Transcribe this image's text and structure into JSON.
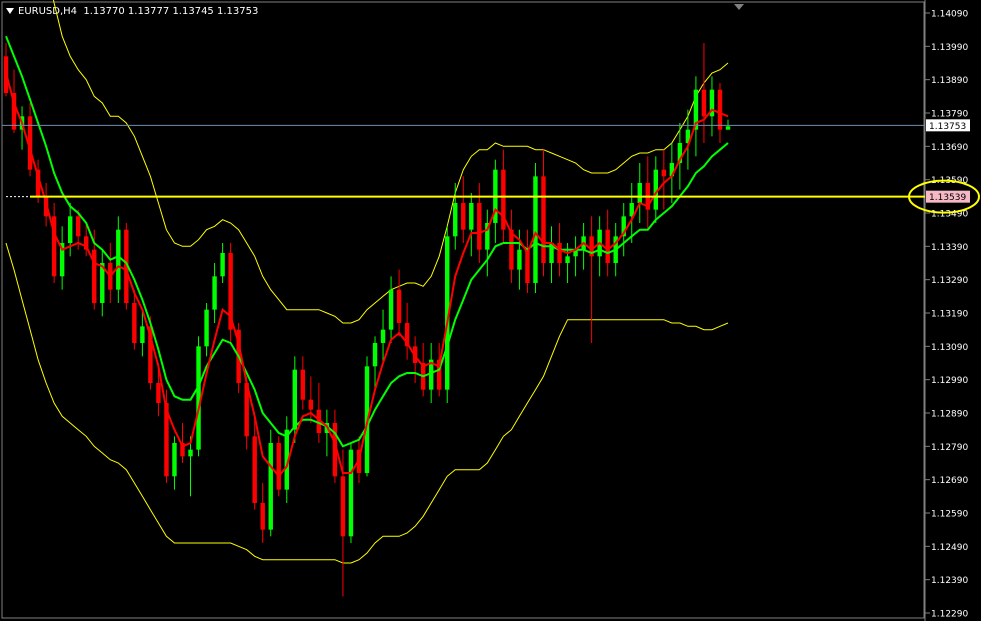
{
  "header": {
    "symbol_timeframe": "EURUSD,H4",
    "ohlc": "1.13770 1.13777 1.13745 1.13753"
  },
  "colors": {
    "background": "#000000",
    "bull_candle": "#00ff00",
    "bear_candle": "#ff0000",
    "ma_fast": "#ff0000",
    "ma_slow": "#00ff00",
    "envelope": "#ffff00",
    "price_line": "#6f8fae",
    "horizontal_line": "#ffff00",
    "highlight_circle": "#ffff00"
  },
  "chart_data": {
    "type": "candlestick",
    "symbol": "EURUSD",
    "timeframe": "H4",
    "ylim": [
      1.1229,
      1.1409
    ],
    "y_ticks": [
      "1.14090",
      "1.13990",
      "1.13890",
      "1.13790",
      "1.13690",
      "1.13590",
      "1.13490",
      "1.13390",
      "1.13290",
      "1.13190",
      "1.13090",
      "1.12990",
      "1.12890",
      "1.12790",
      "1.12690",
      "1.12590",
      "1.12490",
      "1.12390",
      "1.12290"
    ],
    "current_price": 1.13753,
    "current_price_label": "1.13753",
    "horizontal_line": 1.13539,
    "horizontal_line_label": "1.13539",
    "candles": [
      [
        1.1396,
        1.14,
        1.1384,
        1.1385
      ],
      [
        1.1385,
        1.1392,
        1.1373,
        1.1374
      ],
      [
        1.1374,
        1.1381,
        1.1368,
        1.1378
      ],
      [
        1.1378,
        1.1382,
        1.136,
        1.1362
      ],
      [
        1.1362,
        1.1365,
        1.1352,
        1.1354
      ],
      [
        1.1354,
        1.1358,
        1.1345,
        1.1348
      ],
      [
        1.1348,
        1.1352,
        1.1328,
        1.133
      ],
      [
        1.133,
        1.1345,
        1.1326,
        1.134
      ],
      [
        1.134,
        1.1352,
        1.1336,
        1.1348
      ],
      [
        1.1348,
        1.135,
        1.1338,
        1.1342
      ],
      [
        1.1342,
        1.1346,
        1.1336,
        1.1338
      ],
      [
        1.1338,
        1.1344,
        1.132,
        1.1322
      ],
      [
        1.1322,
        1.1338,
        1.1318,
        1.1334
      ],
      [
        1.1334,
        1.134,
        1.1322,
        1.1326
      ],
      [
        1.1326,
        1.1348,
        1.1322,
        1.1344
      ],
      [
        1.1344,
        1.1346,
        1.132,
        1.1322
      ],
      [
        1.1322,
        1.1326,
        1.1308,
        1.131
      ],
      [
        1.131,
        1.132,
        1.1306,
        1.1315
      ],
      [
        1.1315,
        1.1318,
        1.1296,
        1.1298
      ],
      [
        1.1298,
        1.1304,
        1.1288,
        1.1292
      ],
      [
        1.1292,
        1.1296,
        1.1268,
        1.127
      ],
      [
        1.127,
        1.1282,
        1.1266,
        1.128
      ],
      [
        1.128,
        1.1286,
        1.1274,
        1.1276
      ],
      [
        1.1276,
        1.1282,
        1.1264,
        1.1278
      ],
      [
        1.1278,
        1.1312,
        1.1276,
        1.1309
      ],
      [
        1.1309,
        1.1322,
        1.1306,
        1.132
      ],
      [
        1.132,
        1.1334,
        1.1316,
        1.133
      ],
      [
        1.133,
        1.134,
        1.1328,
        1.1337
      ],
      [
        1.1337,
        1.134,
        1.131,
        1.1314
      ],
      [
        1.1314,
        1.1316,
        1.1295,
        1.1298
      ],
      [
        1.1298,
        1.13,
        1.1278,
        1.1282
      ],
      [
        1.1282,
        1.1288,
        1.126,
        1.1262
      ],
      [
        1.1262,
        1.1268,
        1.125,
        1.1254
      ],
      [
        1.1254,
        1.1284,
        1.1252,
        1.128
      ],
      [
        1.128,
        1.1282,
        1.1264,
        1.1266
      ],
      [
        1.1266,
        1.1288,
        1.1262,
        1.1284
      ],
      [
        1.1284,
        1.1306,
        1.128,
        1.1302
      ],
      [
        1.1302,
        1.1306,
        1.129,
        1.1293
      ],
      [
        1.1293,
        1.13,
        1.1286,
        1.129
      ],
      [
        1.129,
        1.1298,
        1.128,
        1.1283
      ],
      [
        1.1283,
        1.129,
        1.1276,
        1.1286
      ],
      [
        1.1286,
        1.129,
        1.1268,
        1.127
      ],
      [
        1.127,
        1.1278,
        1.1234,
        1.1252
      ],
      [
        1.1252,
        1.128,
        1.125,
        1.1278
      ],
      [
        1.1278,
        1.1282,
        1.1268,
        1.1271
      ],
      [
        1.1271,
        1.1306,
        1.127,
        1.1303
      ],
      [
        1.1303,
        1.1312,
        1.1296,
        1.131
      ],
      [
        1.131,
        1.132,
        1.1304,
        1.1314
      ],
      [
        1.1314,
        1.133,
        1.131,
        1.1326
      ],
      [
        1.1326,
        1.1332,
        1.1312,
        1.1316
      ],
      [
        1.1316,
        1.1322,
        1.1305,
        1.1309
      ],
      [
        1.1309,
        1.1312,
        1.1298,
        1.1304
      ],
      [
        1.1304,
        1.131,
        1.1294,
        1.1296
      ],
      [
        1.1296,
        1.131,
        1.1292,
        1.1305
      ],
      [
        1.1305,
        1.131,
        1.1294,
        1.1296
      ],
      [
        1.1296,
        1.1345,
        1.1292,
        1.1342
      ],
      [
        1.1342,
        1.1358,
        1.1338,
        1.1352
      ],
      [
        1.1352,
        1.136,
        1.134,
        1.1344
      ],
      [
        1.1344,
        1.1355,
        1.1336,
        1.1352
      ],
      [
        1.1352,
        1.1358,
        1.1334,
        1.1338
      ],
      [
        1.1338,
        1.135,
        1.133,
        1.1346
      ],
      [
        1.1346,
        1.1365,
        1.134,
        1.1362
      ],
      [
        1.1362,
        1.1368,
        1.134,
        1.1344
      ],
      [
        1.1344,
        1.135,
        1.1328,
        1.1332
      ],
      [
        1.1332,
        1.1344,
        1.1326,
        1.1338
      ],
      [
        1.1338,
        1.1344,
        1.1325,
        1.1328
      ],
      [
        1.1328,
        1.1364,
        1.1325,
        1.136
      ],
      [
        1.136,
        1.1368,
        1.133,
        1.1334
      ],
      [
        1.1334,
        1.1345,
        1.1328,
        1.134
      ],
      [
        1.134,
        1.1346,
        1.133,
        1.1334
      ],
      [
        1.1334,
        1.134,
        1.1328,
        1.1336
      ],
      [
        1.1336,
        1.1342,
        1.133,
        1.1338
      ],
      [
        1.1338,
        1.1346,
        1.1332,
        1.1342
      ],
      [
        1.1342,
        1.1348,
        1.131,
        1.1336
      ],
      [
        1.1336,
        1.1348,
        1.133,
        1.1344
      ],
      [
        1.1344,
        1.135,
        1.133,
        1.1334
      ],
      [
        1.1334,
        1.1346,
        1.133,
        1.1342
      ],
      [
        1.1342,
        1.1352,
        1.1336,
        1.1348
      ],
      [
        1.1348,
        1.1358,
        1.134,
        1.1352
      ],
      [
        1.1352,
        1.1364,
        1.1346,
        1.1358
      ],
      [
        1.1358,
        1.1366,
        1.1344,
        1.135
      ],
      [
        1.135,
        1.1366,
        1.1346,
        1.1362
      ],
      [
        1.1362,
        1.1368,
        1.135,
        1.136
      ],
      [
        1.136,
        1.137,
        1.1352,
        1.1364
      ],
      [
        1.1364,
        1.1376,
        1.1356,
        1.137
      ],
      [
        1.137,
        1.138,
        1.1362,
        1.1374
      ],
      [
        1.1374,
        1.139,
        1.1366,
        1.1386
      ],
      [
        1.1386,
        1.14,
        1.137,
        1.1378
      ],
      [
        1.1378,
        1.139,
        1.1372,
        1.1386
      ],
      [
        1.1386,
        1.1388,
        1.137,
        1.1374
      ],
      [
        1.1374,
        1.1377,
        1.1374,
        1.1375
      ]
    ],
    "ma_fast": [
      1.1391,
      1.1382,
      1.1376,
      1.1368,
      1.136,
      1.1352,
      1.1343,
      1.1338,
      1.1339,
      1.134,
      1.1339,
      1.1334,
      1.1333,
      1.133,
      1.1333,
      1.1332,
      1.1325,
      1.132,
      1.1312,
      1.1303,
      1.129,
      1.1284,
      1.1279,
      1.128,
      1.129,
      1.1301,
      1.1311,
      1.132,
      1.1318,
      1.131,
      1.1298,
      1.1288,
      1.1276,
      1.1273,
      1.127,
      1.1273,
      1.1282,
      1.1288,
      1.1289,
      1.1287,
      1.1285,
      1.128,
      1.1271,
      1.1271,
      1.1275,
      1.1286,
      1.1296,
      1.1304,
      1.1311,
      1.1313,
      1.131,
      1.1306,
      1.1303,
      1.1304,
      1.1303,
      1.1316,
      1.133,
      1.1337,
      1.1343,
      1.1343,
      1.1344,
      1.135,
      1.1348,
      1.1343,
      1.1341,
      1.1337,
      1.1343,
      1.134,
      1.134,
      1.1338,
      1.1337,
      1.1338,
      1.134,
      1.1338,
      1.134,
      1.1338,
      1.134,
      1.1343,
      1.1347,
      1.1352,
      1.1351,
      1.1355,
      1.1358,
      1.136,
      1.1365,
      1.1369,
      1.1376,
      1.1377,
      1.138,
      1.1379,
      1.1378
    ],
    "ma_slow": [
      1.1402,
      1.1396,
      1.139,
      1.1383,
      1.1376,
      1.1369,
      1.1361,
      1.1355,
      1.1351,
      1.1349,
      1.1346,
      1.134,
      1.1338,
      1.1335,
      1.1336,
      1.1334,
      1.1329,
      1.1323,
      1.1316,
      1.1308,
      1.1299,
      1.1294,
      1.1293,
      1.1293,
      1.1297,
      1.1303,
      1.1307,
      1.1311,
      1.131,
      1.1306,
      1.1301,
      1.1296,
      1.1289,
      1.1286,
      1.1283,
      1.1282,
      1.1285,
      1.1287,
      1.1287,
      1.1286,
      1.1285,
      1.1283,
      1.1279,
      1.128,
      1.1281,
      1.1285,
      1.129,
      1.1294,
      1.1298,
      1.13,
      1.1301,
      1.1301,
      1.13,
      1.1301,
      1.1302,
      1.1309,
      1.1317,
      1.1323,
      1.1329,
      1.1332,
      1.1335,
      1.1339,
      1.134,
      1.134,
      1.134,
      1.1338,
      1.134,
      1.1339,
      1.1339,
      1.1338,
      1.1338,
      1.1338,
      1.1338,
      1.1337,
      1.1338,
      1.1337,
      1.1338,
      1.134,
      1.1342,
      1.1344,
      1.1344,
      1.1347,
      1.1349,
      1.1351,
      1.1354,
      1.1357,
      1.1361,
      1.1363,
      1.1366,
      1.1368,
      1.137
    ],
    "env_upper": [
      1.148,
      1.147,
      1.146,
      1.1448,
      1.1436,
      1.1424,
      1.1412,
      1.1402,
      1.1396,
      1.1392,
      1.1389,
      1.1384,
      1.1382,
      1.1378,
      1.1378,
      1.1376,
      1.1372,
      1.1366,
      1.136,
      1.1352,
      1.1344,
      1.134,
      1.1339,
      1.1339,
      1.1341,
      1.1344,
      1.1345,
      1.1347,
      1.1346,
      1.1344,
      1.134,
      1.1336,
      1.133,
      1.1326,
      1.1323,
      1.132,
      1.132,
      1.132,
      1.132,
      1.132,
      1.1319,
      1.1318,
      1.1316,
      1.1316,
      1.1317,
      1.132,
      1.1322,
      1.1324,
      1.1326,
      1.1327,
      1.1328,
      1.1328,
      1.1327,
      1.133,
      1.1336,
      1.1345,
      1.1355,
      1.1362,
      1.1366,
      1.1368,
      1.1368,
      1.137,
      1.1369,
      1.1369,
      1.1369,
      1.1369,
      1.1368,
      1.1368,
      1.1367,
      1.1366,
      1.1365,
      1.1364,
      1.1362,
      1.1361,
      1.1361,
      1.1361,
      1.1362,
      1.1364,
      1.1366,
      1.1367,
      1.1367,
      1.1368,
      1.1368,
      1.137,
      1.1374,
      1.1378,
      1.1384,
      1.1388,
      1.1391,
      1.1392,
      1.1394
    ],
    "env_lower": [
      1.134,
      1.1332,
      1.1323,
      1.1314,
      1.1305,
      1.1298,
      1.1292,
      1.1288,
      1.1286,
      1.1284,
      1.1282,
      1.1279,
      1.1277,
      1.1275,
      1.1274,
      1.1272,
      1.1268,
      1.1264,
      1.126,
      1.1256,
      1.1252,
      1.125,
      1.125,
      1.125,
      1.125,
      1.125,
      1.125,
      1.125,
      1.125,
      1.1249,
      1.1248,
      1.1246,
      1.1245,
      1.1245,
      1.1245,
      1.1245,
      1.1245,
      1.1245,
      1.1245,
      1.1245,
      1.1245,
      1.1245,
      1.1244,
      1.1244,
      1.1245,
      1.1247,
      1.125,
      1.1252,
      1.1252,
      1.1252,
      1.1253,
      1.1255,
      1.1258,
      1.1262,
      1.1266,
      1.127,
      1.1272,
      1.1272,
      1.1272,
      1.1272,
      1.1274,
      1.1278,
      1.1282,
      1.1284,
      1.1288,
      1.1292,
      1.1296,
      1.13,
      1.1306,
      1.1312,
      1.1317,
      1.1317,
      1.1317,
      1.1317,
      1.1317,
      1.1317,
      1.1317,
      1.1317,
      1.1317,
      1.1317,
      1.1317,
      1.1317,
      1.1317,
      1.1316,
      1.1316,
      1.1315,
      1.1315,
      1.1314,
      1.1314,
      1.1315,
      1.1316
    ]
  }
}
